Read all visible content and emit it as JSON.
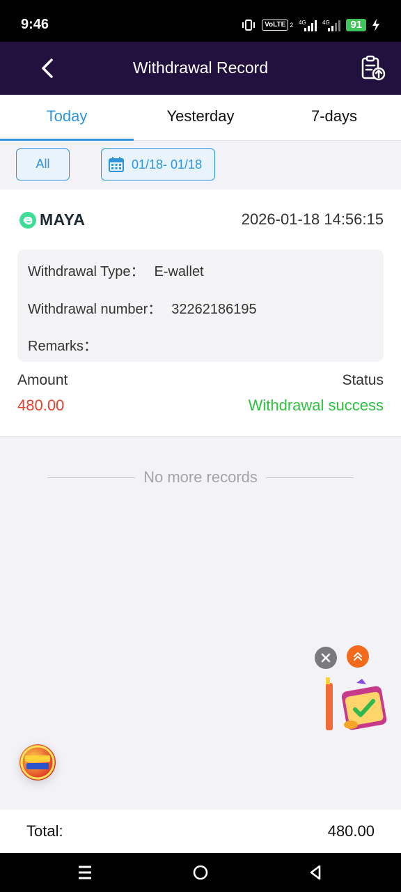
{
  "status_bar": {
    "time": "9:46",
    "volte": "VoLTE",
    "sim_slot": "2",
    "net1": "4G",
    "net2": "4G",
    "battery": "91"
  },
  "header": {
    "title": "Withdrawal Record",
    "back_icon": "chevron-left-icon",
    "record_icon": "clipboard-upload-icon"
  },
  "tabs": [
    {
      "label": "Today",
      "active": true
    },
    {
      "label": "Yesterday",
      "active": false
    },
    {
      "label": "7-days",
      "active": false
    }
  ],
  "filters": {
    "all_label": "All",
    "date_range": "01/18- 01/18"
  },
  "record": {
    "provider": "MAYA",
    "datetime": "2026-01-18 14:56:15",
    "type_label": "Withdrawal Type：",
    "type_value": "E-wallet",
    "number_label": "Withdrawal number：",
    "number_value": "32262186195",
    "remarks_label": "Remarks：",
    "remarks_value": "",
    "amount_label": "Amount",
    "amount_value": "480.00",
    "status_label": "Status",
    "status_value": "Withdrawal success"
  },
  "list_end": "No more records",
  "total": {
    "label": "Total:",
    "value": "480.00"
  },
  "colors": {
    "header_bg": "#22103f",
    "accent": "#2e95d9",
    "amount": "#e6402b",
    "success": "#2ec23f"
  }
}
